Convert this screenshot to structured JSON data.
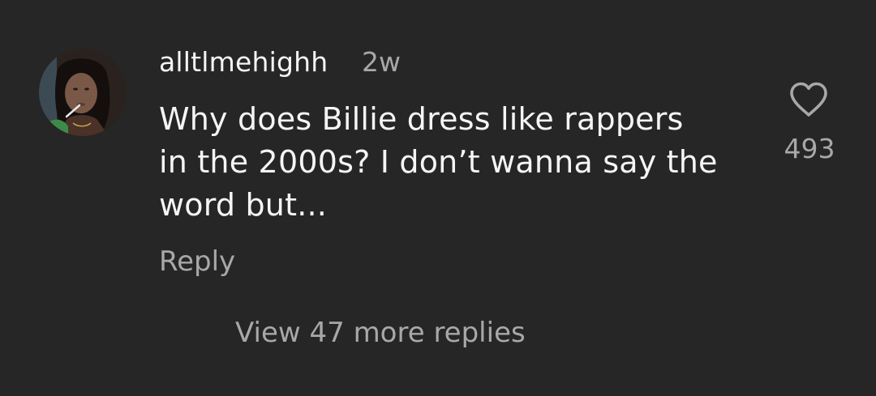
{
  "comment": {
    "username": "alltlmehighh",
    "timestamp": "2w",
    "text_lines": [
      "Why does Billie dress like rappers",
      "in the 2000s? I don’t wanna say the",
      "word but..."
    ],
    "reply_label": "Reply",
    "like_count": "493",
    "view_replies_label": "View 47 more replies"
  },
  "icons": {
    "like": "heart-outline-icon",
    "avatar": "user-avatar"
  },
  "colors": {
    "background": "#262626",
    "primary_text": "#f5f5f5",
    "secondary_text": "#a8a8a8"
  }
}
